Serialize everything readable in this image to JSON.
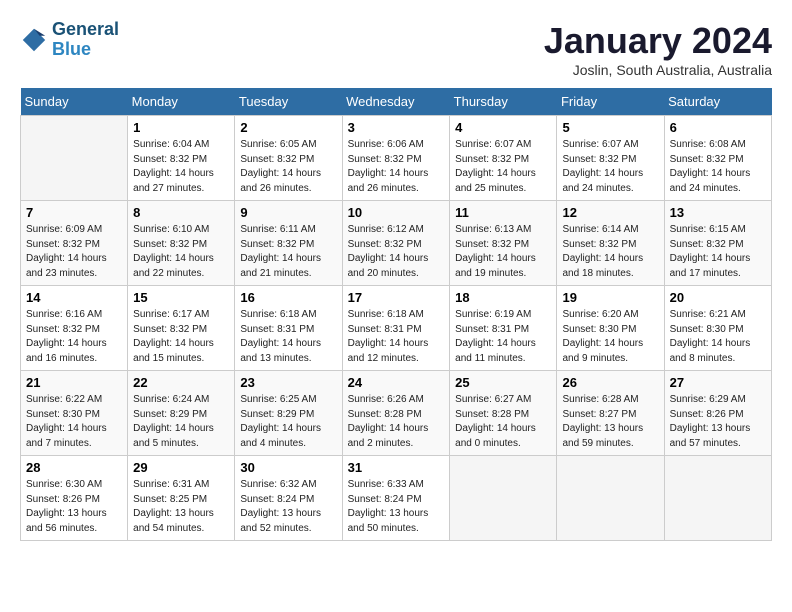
{
  "header": {
    "logo_line1": "General",
    "logo_line2": "Blue",
    "month_title": "January 2024",
    "location": "Joslin, South Australia, Australia"
  },
  "weekdays": [
    "Sunday",
    "Monday",
    "Tuesday",
    "Wednesday",
    "Thursday",
    "Friday",
    "Saturday"
  ],
  "weeks": [
    [
      {
        "day": "",
        "info": ""
      },
      {
        "day": "1",
        "info": "Sunrise: 6:04 AM\nSunset: 8:32 PM\nDaylight: 14 hours\nand 27 minutes."
      },
      {
        "day": "2",
        "info": "Sunrise: 6:05 AM\nSunset: 8:32 PM\nDaylight: 14 hours\nand 26 minutes."
      },
      {
        "day": "3",
        "info": "Sunrise: 6:06 AM\nSunset: 8:32 PM\nDaylight: 14 hours\nand 26 minutes."
      },
      {
        "day": "4",
        "info": "Sunrise: 6:07 AM\nSunset: 8:32 PM\nDaylight: 14 hours\nand 25 minutes."
      },
      {
        "day": "5",
        "info": "Sunrise: 6:07 AM\nSunset: 8:32 PM\nDaylight: 14 hours\nand 24 minutes."
      },
      {
        "day": "6",
        "info": "Sunrise: 6:08 AM\nSunset: 8:32 PM\nDaylight: 14 hours\nand 24 minutes."
      }
    ],
    [
      {
        "day": "7",
        "info": "Sunrise: 6:09 AM\nSunset: 8:32 PM\nDaylight: 14 hours\nand 23 minutes."
      },
      {
        "day": "8",
        "info": "Sunrise: 6:10 AM\nSunset: 8:32 PM\nDaylight: 14 hours\nand 22 minutes."
      },
      {
        "day": "9",
        "info": "Sunrise: 6:11 AM\nSunset: 8:32 PM\nDaylight: 14 hours\nand 21 minutes."
      },
      {
        "day": "10",
        "info": "Sunrise: 6:12 AM\nSunset: 8:32 PM\nDaylight: 14 hours\nand 20 minutes."
      },
      {
        "day": "11",
        "info": "Sunrise: 6:13 AM\nSunset: 8:32 PM\nDaylight: 14 hours\nand 19 minutes."
      },
      {
        "day": "12",
        "info": "Sunrise: 6:14 AM\nSunset: 8:32 PM\nDaylight: 14 hours\nand 18 minutes."
      },
      {
        "day": "13",
        "info": "Sunrise: 6:15 AM\nSunset: 8:32 PM\nDaylight: 14 hours\nand 17 minutes."
      }
    ],
    [
      {
        "day": "14",
        "info": "Sunrise: 6:16 AM\nSunset: 8:32 PM\nDaylight: 14 hours\nand 16 minutes."
      },
      {
        "day": "15",
        "info": "Sunrise: 6:17 AM\nSunset: 8:32 PM\nDaylight: 14 hours\nand 15 minutes."
      },
      {
        "day": "16",
        "info": "Sunrise: 6:18 AM\nSunset: 8:31 PM\nDaylight: 14 hours\nand 13 minutes."
      },
      {
        "day": "17",
        "info": "Sunrise: 6:18 AM\nSunset: 8:31 PM\nDaylight: 14 hours\nand 12 minutes."
      },
      {
        "day": "18",
        "info": "Sunrise: 6:19 AM\nSunset: 8:31 PM\nDaylight: 14 hours\nand 11 minutes."
      },
      {
        "day": "19",
        "info": "Sunrise: 6:20 AM\nSunset: 8:30 PM\nDaylight: 14 hours\nand 9 minutes."
      },
      {
        "day": "20",
        "info": "Sunrise: 6:21 AM\nSunset: 8:30 PM\nDaylight: 14 hours\nand 8 minutes."
      }
    ],
    [
      {
        "day": "21",
        "info": "Sunrise: 6:22 AM\nSunset: 8:30 PM\nDaylight: 14 hours\nand 7 minutes."
      },
      {
        "day": "22",
        "info": "Sunrise: 6:24 AM\nSunset: 8:29 PM\nDaylight: 14 hours\nand 5 minutes."
      },
      {
        "day": "23",
        "info": "Sunrise: 6:25 AM\nSunset: 8:29 PM\nDaylight: 14 hours\nand 4 minutes."
      },
      {
        "day": "24",
        "info": "Sunrise: 6:26 AM\nSunset: 8:28 PM\nDaylight: 14 hours\nand 2 minutes."
      },
      {
        "day": "25",
        "info": "Sunrise: 6:27 AM\nSunset: 8:28 PM\nDaylight: 14 hours\nand 0 minutes."
      },
      {
        "day": "26",
        "info": "Sunrise: 6:28 AM\nSunset: 8:27 PM\nDaylight: 13 hours\nand 59 minutes."
      },
      {
        "day": "27",
        "info": "Sunrise: 6:29 AM\nSunset: 8:26 PM\nDaylight: 13 hours\nand 57 minutes."
      }
    ],
    [
      {
        "day": "28",
        "info": "Sunrise: 6:30 AM\nSunset: 8:26 PM\nDaylight: 13 hours\nand 56 minutes."
      },
      {
        "day": "29",
        "info": "Sunrise: 6:31 AM\nSunset: 8:25 PM\nDaylight: 13 hours\nand 54 minutes."
      },
      {
        "day": "30",
        "info": "Sunrise: 6:32 AM\nSunset: 8:24 PM\nDaylight: 13 hours\nand 52 minutes."
      },
      {
        "day": "31",
        "info": "Sunrise: 6:33 AM\nSunset: 8:24 PM\nDaylight: 13 hours\nand 50 minutes."
      },
      {
        "day": "",
        "info": ""
      },
      {
        "day": "",
        "info": ""
      },
      {
        "day": "",
        "info": ""
      }
    ]
  ]
}
